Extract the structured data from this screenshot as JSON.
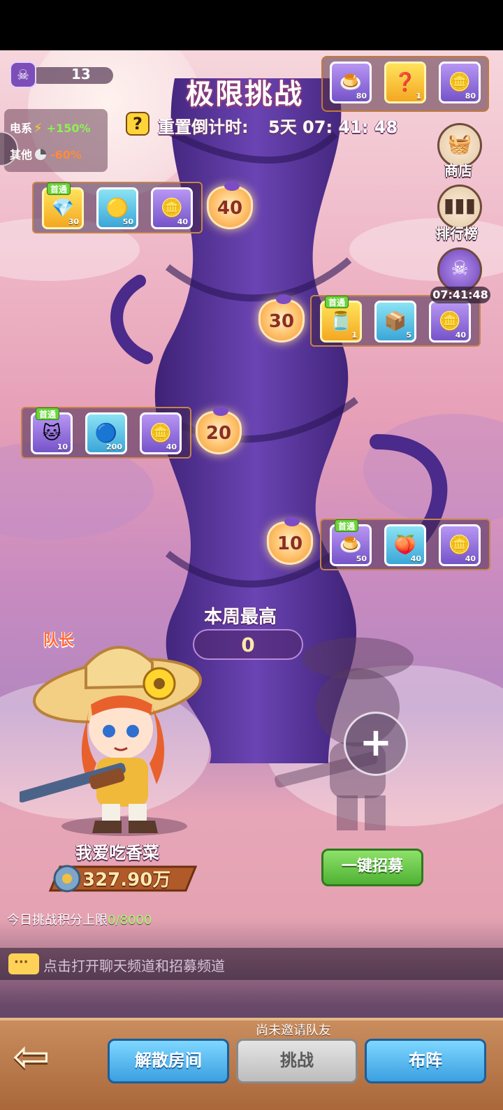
{
  "header": {
    "skull_count": "13",
    "title": "极限挑战",
    "reset_label": "重置倒计时:",
    "reset_time": "5天 07: 41: 48"
  },
  "buffs": {
    "electric_label": "电系",
    "electric_value": "+150%",
    "other_label": "其他",
    "other_value": "-60%"
  },
  "top_rewards": [
    {
      "icon": "pudding-icon",
      "count": "80"
    },
    {
      "icon": "mystery-token-icon",
      "count": "1"
    },
    {
      "icon": "silver-coin-icon",
      "count": "80"
    }
  ],
  "levels": [
    {
      "level": "40",
      "first_clear": "首通",
      "rewards": [
        {
          "icon": "diamond-icon",
          "count": "30"
        },
        {
          "icon": "gold-coin-icon",
          "count": "50"
        },
        {
          "icon": "silver-coin-icon",
          "count": "40"
        }
      ]
    },
    {
      "level": "30",
      "first_clear": "首通",
      "rewards": [
        {
          "icon": "jar-icon",
          "count": "1"
        },
        {
          "icon": "mystery-box-icon",
          "count": "5"
        },
        {
          "icon": "silver-coin-icon",
          "count": "40"
        }
      ]
    },
    {
      "level": "20",
      "first_clear": "首通",
      "rewards": [
        {
          "icon": "pet-icon",
          "count": "10"
        },
        {
          "icon": "blue-flame-icon",
          "count": "200"
        },
        {
          "icon": "silver-coin-icon",
          "count": "40"
        }
      ]
    },
    {
      "level": "10",
      "first_clear": "首通",
      "rewards": [
        {
          "icon": "pudding-icon",
          "count": "50"
        },
        {
          "icon": "fruit-icon",
          "count": "40"
        },
        {
          "icon": "silver-coin-icon",
          "count": "40"
        }
      ]
    }
  ],
  "side": {
    "shop_label": "商店",
    "rank_label": "排行榜",
    "boss_timer": "07:41:48"
  },
  "week_best": {
    "label": "本周最高",
    "value": "0"
  },
  "team": {
    "captain_label": "队长",
    "hero_name": "我爱吃香菜",
    "power": "327.90万",
    "daily_label": "今日挑战积分上限",
    "daily_value": "0/8000",
    "recruit_label": "一键招募"
  },
  "chat": {
    "hint": "点击打开聊天频道和招募频道"
  },
  "bottom": {
    "no_invite": "尚未邀请队友",
    "disband": "解散房间",
    "challenge": "挑战",
    "formation": "布阵"
  },
  "colors": {
    "sky_top": "#f6d6dc",
    "stalk": "#5b3aa0",
    "accent_green": "#4fb133",
    "accent_blue": "#3b9fe0"
  }
}
